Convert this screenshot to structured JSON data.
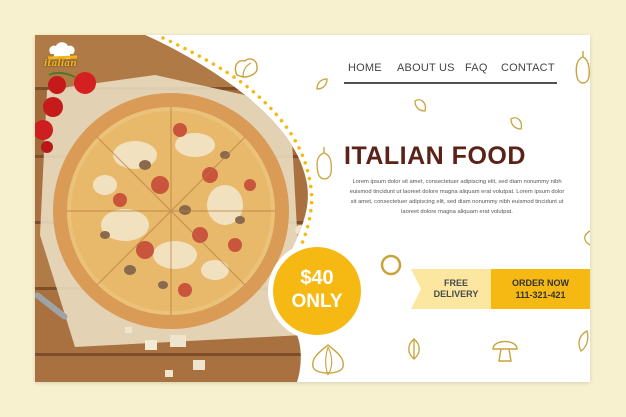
{
  "brand": {
    "logo_text": "italian"
  },
  "nav": {
    "items": [
      {
        "label": "HOME"
      },
      {
        "label": "ABOUT US"
      },
      {
        "label": "FAQ"
      },
      {
        "label": "CONTACT"
      }
    ]
  },
  "hero": {
    "title": "ITALIAN FOOD",
    "body": "Lorem ipsum dolor sit amet, consectetuer adipiscing elit, sed diam nonummy nibh euismod tincidunt ut laoreet dolore magna aliquam erat volutpat. Lorem ipsum dolor sit amet, consectetuer adipiscing elit, sed diam nonummy nibh euismod tincidunt ut laoreet dolore magna aliquam erat volutpat."
  },
  "promo": {
    "price": "$40",
    "qualifier": "ONLY"
  },
  "delivery": {
    "line1": "FREE",
    "line2": "DELIVERY"
  },
  "order": {
    "label": "ORDER NOW",
    "phone": "111-321-421"
  },
  "colors": {
    "accent": "#f6b913",
    "title": "#5b2218",
    "background": "#f7f1cf",
    "doodle": "#c9a23a"
  }
}
